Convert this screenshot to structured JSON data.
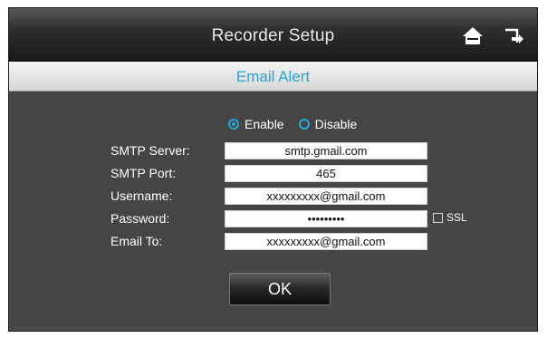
{
  "window": {
    "title": "Recorder Setup",
    "home_icon": "home-icon",
    "back_icon": "back-exit-icon"
  },
  "section": {
    "title": "Email Alert"
  },
  "enable": {
    "options": [
      {
        "label": "Enable",
        "selected": true
      },
      {
        "label": "Disable",
        "selected": false
      }
    ]
  },
  "form": {
    "smtp_server": {
      "label": "SMTP Server:",
      "value": "smtp.gmail.com"
    },
    "smtp_port": {
      "label": "SMTP Port:",
      "value": "465"
    },
    "username": {
      "label": "Username:",
      "value": "xxxxxxxxx@gmail.com"
    },
    "password": {
      "label": "Password:",
      "value": "•••••••••"
    },
    "email_to": {
      "label": "Email To:",
      "value": "xxxxxxxxx@gmail.com"
    },
    "ssl": {
      "label": "SSL",
      "checked": false
    }
  },
  "actions": {
    "ok_label": "OK"
  },
  "colors": {
    "accent": "#2aa6d6",
    "panel": "#454545",
    "titlebar": "#1a1a1a"
  }
}
